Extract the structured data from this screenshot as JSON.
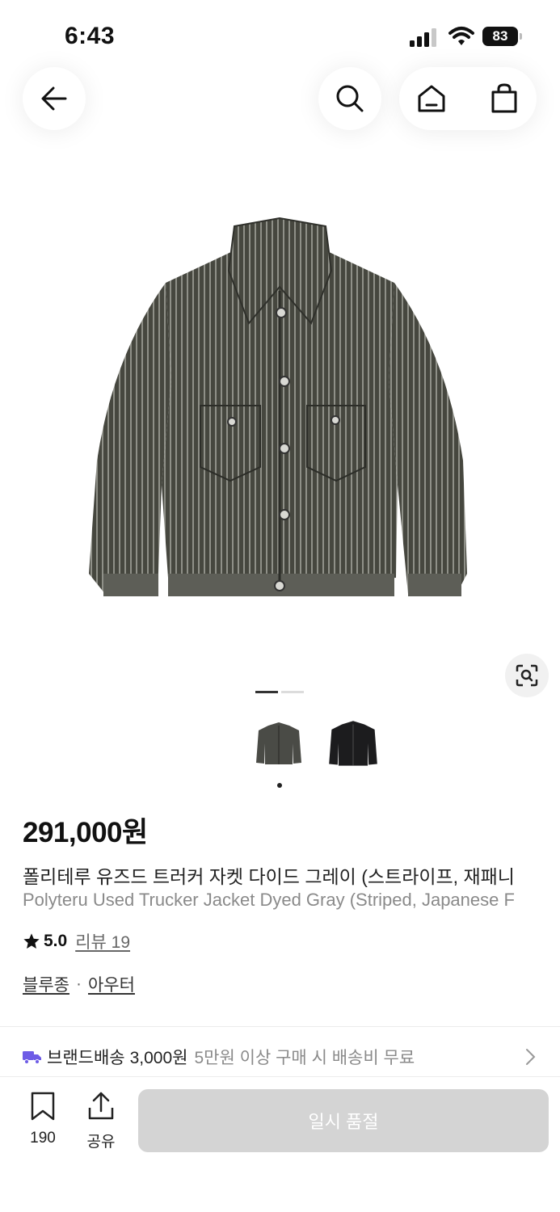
{
  "status_bar": {
    "time": "6:43",
    "battery": "83"
  },
  "header": {
    "back_icon": "arrow-left-icon",
    "search_icon": "search-icon",
    "home_icon": "home-icon",
    "bag_icon": "shopping-bag-icon"
  },
  "gallery": {
    "image": "striped gray trucker jacket",
    "page_count": 2,
    "current_page": 1,
    "lens_icon": "visual-search-icon"
  },
  "color_options": [
    {
      "name": "gray",
      "color": "#4a4b46",
      "selected": true
    },
    {
      "name": "black",
      "color": "#1c1c1e",
      "selected": false
    }
  ],
  "product": {
    "price": "291,000원",
    "name_ko": "폴리테루 유즈드 트러커 자켓 다이드 그레이 (스트라이프, 재패니",
    "name_en": "Polyteru Used Trucker Jacket Dyed Gray (Striped, Japanese F",
    "rating": "5.0",
    "review_label": "리뷰 19",
    "category_1": "블루종",
    "category_sep": "·",
    "category_2": "아우터"
  },
  "shipping": {
    "label": "브랜드배송",
    "fee": "3,000원",
    "note": "5만원 이상 구매 시 배송비 무료",
    "accent": "#6e5ce6"
  },
  "bottom_bar": {
    "bookmark_count": "190",
    "share_label": "공유",
    "soldout_label": "일시 품절"
  }
}
